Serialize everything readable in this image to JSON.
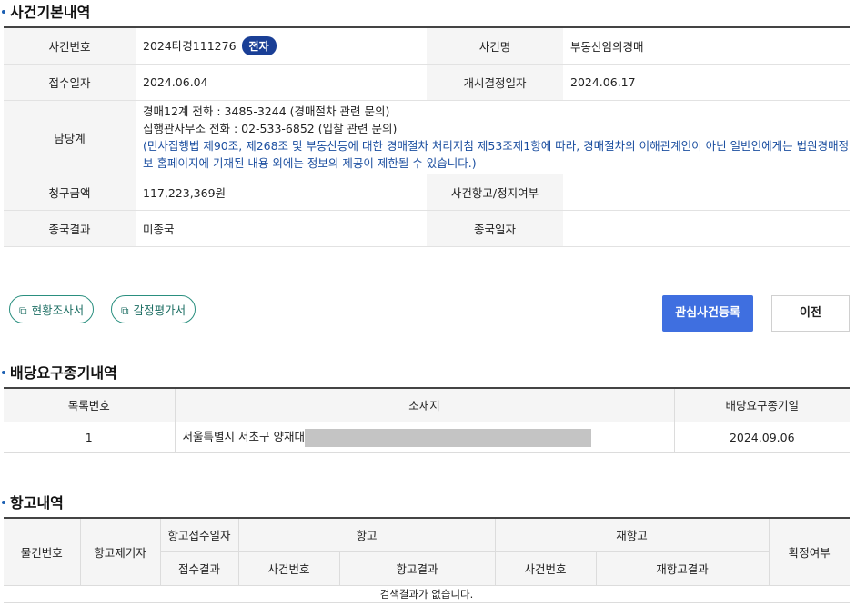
{
  "basic": {
    "title": "사건기본내역",
    "case_no_label": "사건번호",
    "case_no": "2024타경111276",
    "case_badge": "전자",
    "case_name_label": "사건명",
    "case_name": "부동산임의경매",
    "receipt_date_label": "접수일자",
    "receipt_date": "2024.06.04",
    "start_date_label": "개시결정일자",
    "start_date": "2024.06.17",
    "officer_label": "담당계",
    "officer_line1": "경매12계  전화 : 3485-3244 (경매절차 관련 문의)",
    "officer_line2": "집행관사무소   전화 : 02-533-6852 (입찰 관련 문의)",
    "officer_notice": "(민사집행법 제90조, 제268조 및 부동산등에 대한 경매절차 처리지침 제53조제1항에 따라, 경매절차의 이해관계인이 아닌 일반인에게는 법원경매정보 홈페이지에 기재된 내용 외에는 정보의 제공이 제한될 수 있습니다.)",
    "claim_label": "청구금액",
    "claim_amount": "117,223,369원",
    "appeal_stop_label": "사건항고/정지여부",
    "appeal_stop": "",
    "final_result_label": "종국결과",
    "final_result": "미종국",
    "final_date_label": "종국일자",
    "final_date": ""
  },
  "buttons": {
    "survey": "현황조사서",
    "appraisal": "감정평가서",
    "register": "관심사건등록",
    "prev": "이전"
  },
  "dividend": {
    "title": "배당요구종기내역",
    "headers": [
      "목록번호",
      "소재지",
      "배당요구종기일"
    ],
    "rows": [
      {
        "no": "1",
        "address": "서울특별시 서초구 양재대",
        "date": "2024.09.06"
      }
    ]
  },
  "appeal": {
    "title": "항고내역",
    "h_item_no": "물건번호",
    "h_appellant": "항고제기자",
    "h_receipt_date": "항고접수일자",
    "h_appeal": "항고",
    "h_reappeal": "재항고",
    "h_confirm": "확정여부",
    "h_receipt_result": "접수결과",
    "h_case_no": "사건번호",
    "h_appeal_result": "항고결과",
    "h_re_case_no": "사건번호",
    "h_reappeal_result": "재항고결과",
    "empty": "검색결과가 없습니다."
  },
  "colors": {
    "accent_blue": "#3f6fe0",
    "badge_navy": "#1a3f96",
    "doc_button_green": "#2a8f7f",
    "notice_blue": "#1c4fa0"
  }
}
